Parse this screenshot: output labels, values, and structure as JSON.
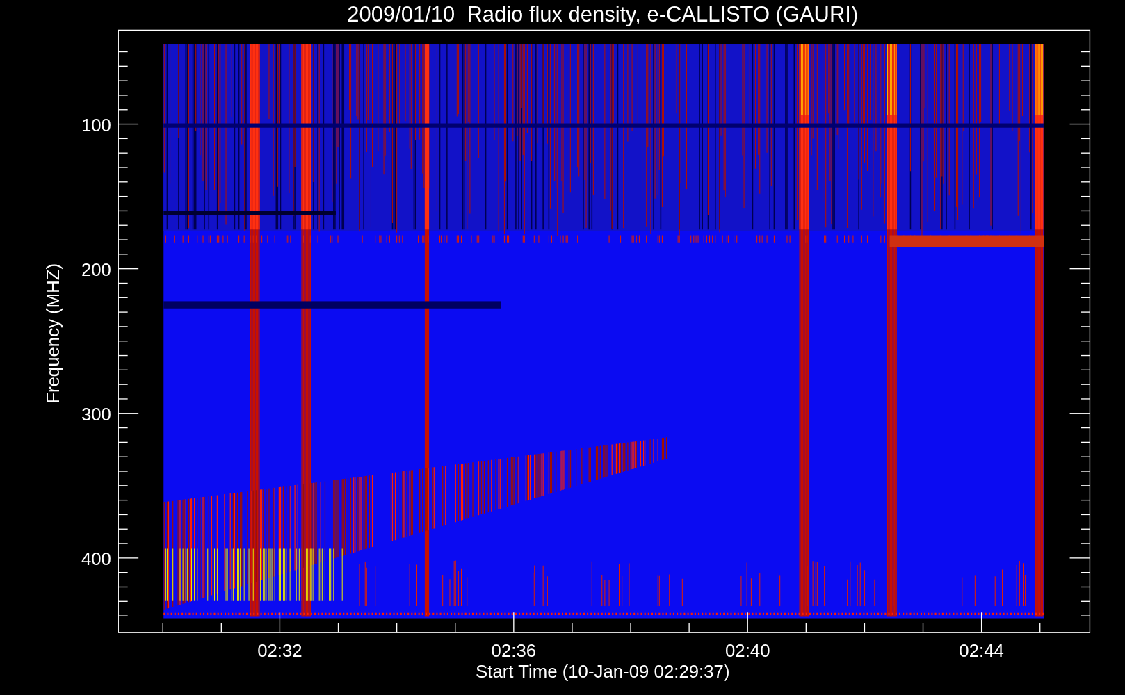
{
  "title": "2009/01/10  Radio flux density, e-CALLISTO (GAURI)",
  "y_axis": {
    "label": "Frequency (MHZ)",
    "ticks": [
      "100",
      "200",
      "300",
      "400"
    ]
  },
  "x_axis": {
    "label": "Start Time (10-Jan-09 02:29:37)",
    "ticks": [
      "02:32",
      "02:36",
      "02:40",
      "02:44"
    ]
  }
}
